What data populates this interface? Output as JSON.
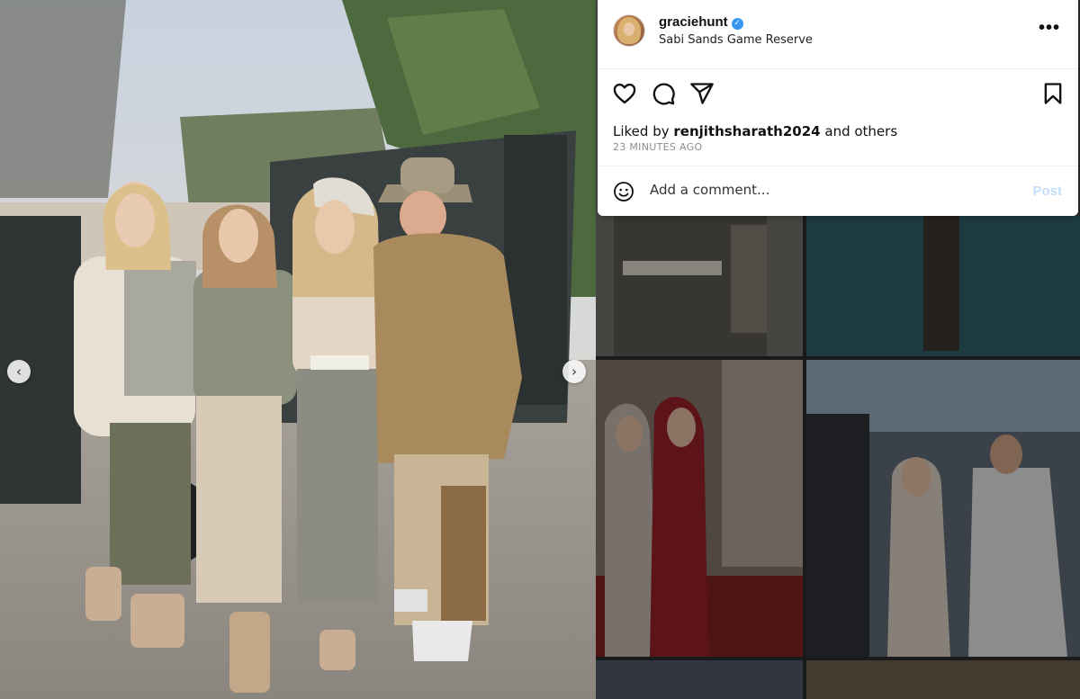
{
  "post": {
    "username": "graciehunt",
    "location": "Sabi Sands Game Reserve",
    "more_label": "•••",
    "liked_prefix": "Liked by ",
    "liked_user": "renjithsharath2024",
    "liked_suffix": " and others",
    "time": "23 MINUTES AGO",
    "comment_placeholder": "Add a comment...",
    "post_label": "Post"
  },
  "carousel": {
    "prev": "‹",
    "next": "›"
  },
  "icons": {
    "like": "heart-icon",
    "comment": "comment-bubble-icon",
    "share": "paper-plane-icon",
    "save": "bookmark-icon",
    "emoji": "smiley-icon",
    "verified": "verified-badge-icon"
  },
  "colors": {
    "verified": "#3897f0",
    "post_disabled": "#c3defa",
    "muted_text": "#8e8e8e"
  }
}
